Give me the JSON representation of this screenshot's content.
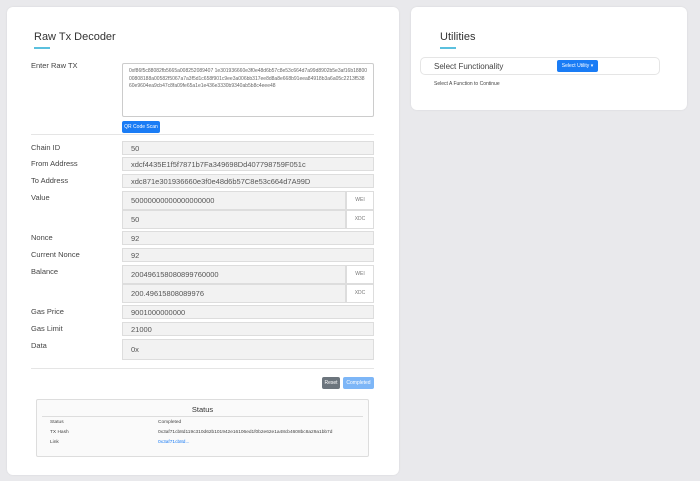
{
  "decoder": {
    "title": "Raw Tx Decoder",
    "raw_tx_label": "Enter Raw TX",
    "raw_tx_value": "0xf86f5c88082fb5665a008252089407 1e301936660e3f0e48d6b57c8e53c664d7a99d8902b5e3af16b1880000808188a00582f5067a7a3f5d1c658f901c9ee3a006bb317ee8d8a8e668b91eea84918b3a6a05c2213f53860e9604ea9cb47c8fa09fe65a1e1e436e3330b9340ab5b8c4eee48",
    "qr_button": "QR Code Scan",
    "fields": {
      "chain_id": {
        "label": "Chain ID",
        "value": "50"
      },
      "from": {
        "label": "From Address",
        "value": "xdcf4435E1f5f7871b7Fa349698Dd407798759F051c"
      },
      "to": {
        "label": "To Address",
        "value": "xdc871e301936660e3f0e48d6b57C8e53c664d7A99D"
      },
      "value": {
        "label": "Value",
        "wei": "50000000000000000000",
        "xdc": "50"
      },
      "nonce": {
        "label": "Nonce",
        "value": "92"
      },
      "current_nonce": {
        "label": "Current Nonce",
        "value": "92"
      },
      "balance": {
        "label": "Balance",
        "wei": "200496158080899760000",
        "xdc": "200.49615808089976"
      },
      "gas_price": {
        "label": "Gas Price",
        "value": "9001000000000"
      },
      "gas_limit": {
        "label": "Gas Limit",
        "value": "21000"
      },
      "data": {
        "label": "Data",
        "value": "0x"
      }
    },
    "unit_wei": "WEI",
    "unit_xdc": "XDC",
    "reset_button": "Reset",
    "completed_button": "Completed",
    "status": {
      "title": "Status",
      "rows": [
        {
          "label": "Status",
          "value": "Completed"
        },
        {
          "label": "TX Hash",
          "value": "0x3af71cb8d119c310d62b101942e16106ed1f0b2e62e1a48cb4608bc8a29a1bb7d"
        },
        {
          "label": "Link",
          "value": "0x3af71cb8d..."
        }
      ]
    }
  },
  "utilities": {
    "title": "Utilities",
    "select_label": "Select Functionality",
    "select_button": "Select Utility",
    "hint": "Select A Function to Continue"
  }
}
